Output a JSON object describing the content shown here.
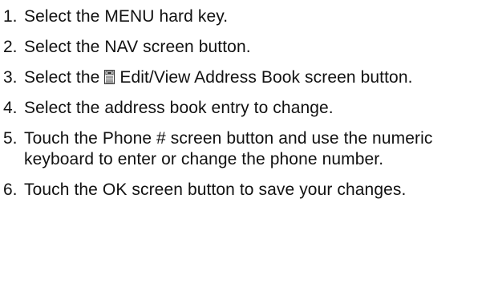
{
  "steps": [
    {
      "num": "1.",
      "text": "Select the MENU hard key."
    },
    {
      "num": "2.",
      "text": "Select the NAV screen button."
    },
    {
      "num": "3.",
      "text_before": "Select the",
      "icon": "address-book-icon",
      "text_after": "Edit/View Address Book screen button."
    },
    {
      "num": "4.",
      "text": "Select the address book entry to change."
    },
    {
      "num": "5.",
      "text": "Touch the Phone # screen button and use the numeric keyboard to enter or change the phone number."
    },
    {
      "num": "6.",
      "text": "Touch the OK screen button to save your changes."
    }
  ]
}
